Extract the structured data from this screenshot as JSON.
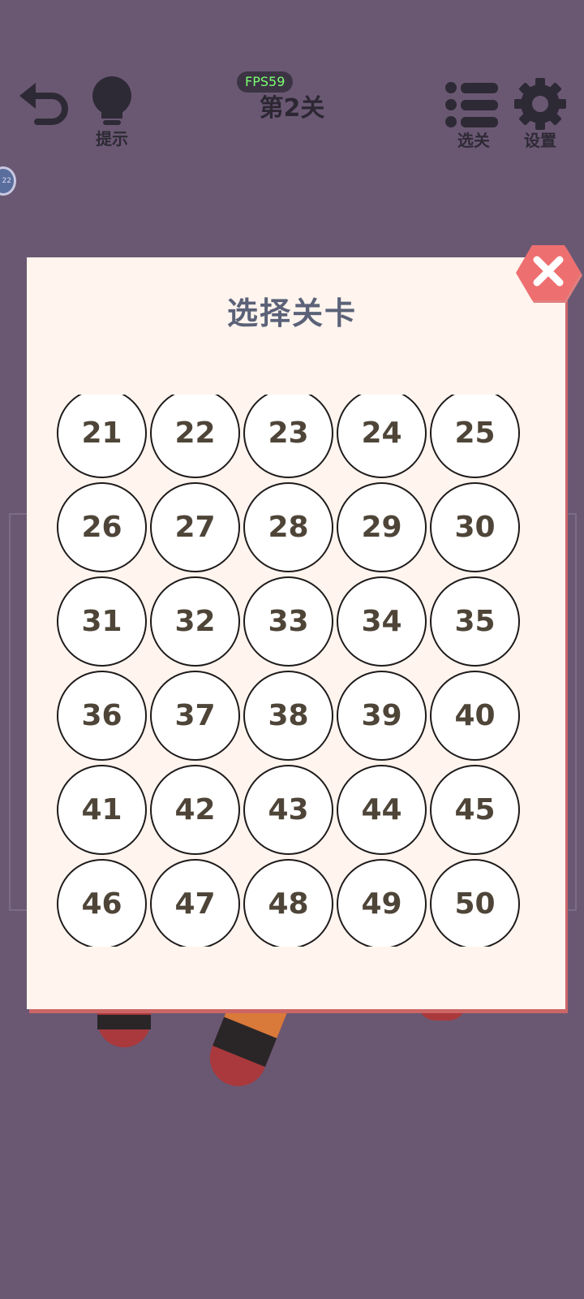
{
  "topbar": {
    "undo": {
      "icon": "undo-icon"
    },
    "hint": {
      "icon": "lightbulb-icon",
      "label": "提示"
    },
    "levels": {
      "icon": "list-icon",
      "label": "选关"
    },
    "settings": {
      "icon": "gear-icon",
      "label": "设置"
    },
    "fps": "FPS59",
    "level_title": "第2关"
  },
  "level_chip": "22",
  "modal": {
    "title": "选择关卡",
    "close_icon": "close-icon",
    "levels": [
      "21",
      "22",
      "23",
      "24",
      "25",
      "26",
      "27",
      "28",
      "29",
      "30",
      "31",
      "32",
      "33",
      "34",
      "35",
      "36",
      "37",
      "38",
      "39",
      "40",
      "41",
      "42",
      "43",
      "44",
      "45",
      "46",
      "47",
      "48",
      "49",
      "50"
    ]
  },
  "colors": {
    "background": "#6a5873",
    "modal": "#fff4ee",
    "close": "#ee6f70",
    "title": "#5b6278",
    "level_text": "#4e4538"
  }
}
